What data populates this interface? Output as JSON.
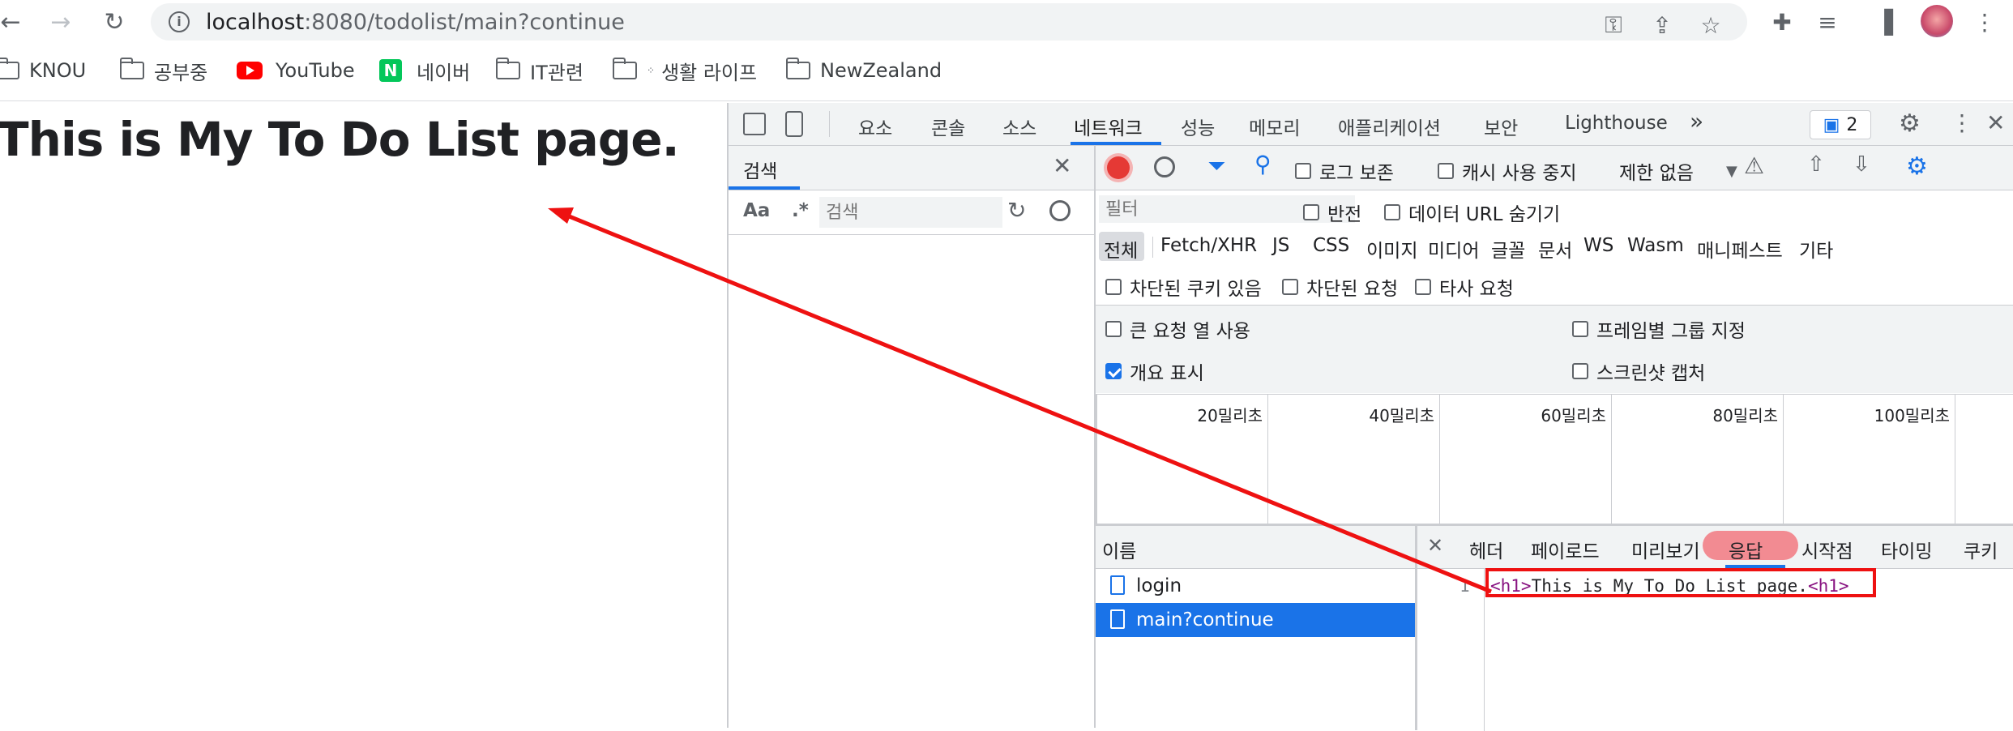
{
  "browser": {
    "url_host": "localhost",
    "url_path": ":8080/todolist/main?continue",
    "bookmarks": [
      "KNOU",
      "공부중",
      "YouTube",
      "네이버",
      "IT관련",
      "생활 라이프",
      "NewZealand"
    ]
  },
  "page": {
    "heading": "This is My To Do List page."
  },
  "devtools": {
    "tabs": [
      "요소",
      "콘솔",
      "소스",
      "네트워크",
      "성능",
      "메모리",
      "애플리케이션",
      "보안",
      "Lighthouse"
    ],
    "more_tabs": "»",
    "issues_count": "2",
    "search": {
      "title": "검색",
      "case_label": "Aa",
      "regex_label": ".*",
      "placeholder": "검색"
    },
    "network": {
      "preserve_log": "로그 보존",
      "disable_cache": "캐시 사용 중지",
      "throttle": "제한 없음",
      "filter_placeholder": "필터",
      "invert": "반전",
      "hide_data_urls": "데이터 URL 숨기기",
      "filter_types": [
        "전체",
        "Fetch/XHR",
        "JS",
        "CSS",
        "이미지",
        "미디어",
        "글꼴",
        "문서",
        "WS",
        "Wasm",
        "매니페스트",
        "기타"
      ],
      "blocked_cookies": "차단된 쿠키 있음",
      "blocked_requests": "차단된 요청",
      "third_party": "타사 요청",
      "large_rows": "큰 요청 열 사용",
      "group_by_frame": "프레임별 그룹 지정",
      "overview": "개요 표시",
      "screenshots": "스크린샷 캡처",
      "timeline_ticks": [
        "20밀리초",
        "40밀리초",
        "60밀리초",
        "80밀리초",
        "100밀리초"
      ],
      "name_header": "이름",
      "requests": [
        "login",
        "main?continue"
      ],
      "detail_tabs": [
        "헤더",
        "페이로드",
        "미리보기",
        "응답",
        "시작점",
        "타이밍",
        "쿠키"
      ],
      "response_line_no": "1",
      "response_tag_open": "<h1>",
      "response_text": "This is My To Do List page.",
      "response_tag_close": "<h1>"
    }
  },
  "colors": {
    "accent": "#1a73e8",
    "annotation": "#ee1111",
    "selected_row": "#1a73e8",
    "tag": "#881280"
  }
}
